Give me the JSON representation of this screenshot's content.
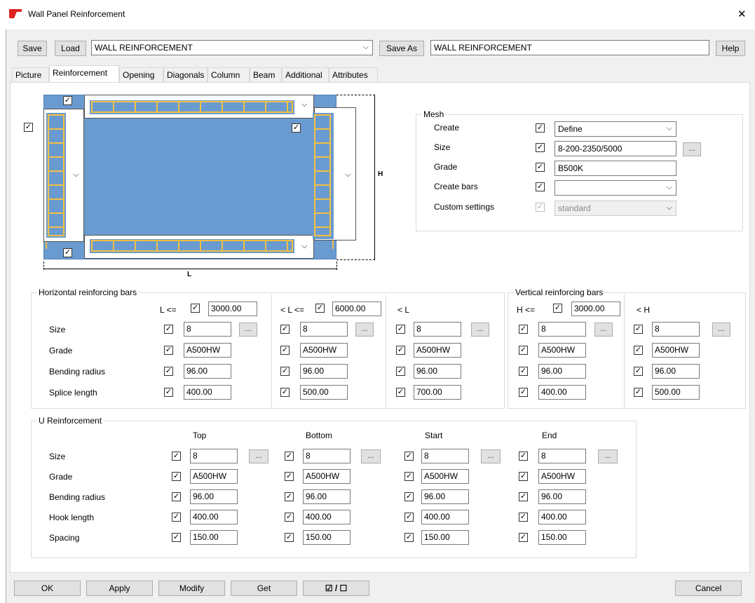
{
  "window": {
    "title": "Wall Panel Reinforcement",
    "close": "✕"
  },
  "toolbar": {
    "save": "Save",
    "load": "Load",
    "preset": "WALL REINFORCEMENT",
    "save_as": "Save As",
    "save_as_name": "WALL REINFORCEMENT",
    "help": "Help"
  },
  "tabs": [
    "Picture",
    "Reinforcement",
    "Opening",
    "Diagonals",
    "Column",
    "Beam",
    "Additional",
    "Attributes"
  ],
  "picture": {
    "h_label": "H",
    "l_label": "L"
  },
  "mesh": {
    "title": "Mesh",
    "rows": [
      {
        "label": "Create",
        "value": "Define"
      },
      {
        "label": "Size",
        "value": "8-200-2350/5000"
      },
      {
        "label": "Grade",
        "value": "B500K"
      },
      {
        "label": "Create bars",
        "value": ""
      },
      {
        "label": "Custom settings",
        "value": "standard"
      }
    ]
  },
  "horizontal": {
    "title": "Horizontal reinforcing bars",
    "cond": [
      {
        "label": "L <=",
        "value": "3000.00"
      },
      {
        "label": "< L <=",
        "value": "6000.00"
      },
      {
        "label": "< L",
        "value": ""
      }
    ],
    "rows": [
      "Size",
      "Grade",
      "Bending radius",
      "Splice length"
    ],
    "cols": [
      [
        "8",
        "A500HW",
        "96.00",
        "400.00"
      ],
      [
        "8",
        "A500HW",
        "96.00",
        "500.00"
      ],
      [
        "8",
        "A500HW",
        "96.00",
        "700.00"
      ]
    ]
  },
  "vertical": {
    "title": "Vertical reinforcing bars",
    "cond": [
      {
        "label": "H <=",
        "value": "3000.00"
      },
      {
        "label": "< H",
        "value": ""
      }
    ],
    "cols": [
      [
        "8",
        "A500HW",
        "96.00",
        "400.00"
      ],
      [
        "8",
        "A500HW",
        "96.00",
        "500.00"
      ]
    ]
  },
  "u": {
    "title": "U Reinforcement",
    "headers": [
      "Top",
      "Bottom",
      "Start",
      "End"
    ],
    "rows": [
      "Size",
      "Grade",
      "Bending radius",
      "Hook length",
      "Spacing"
    ],
    "cols": [
      [
        "8",
        "A500HW",
        "96.00",
        "400.00",
        "150.00"
      ],
      [
        "8",
        "A500HW",
        "96.00",
        "400.00",
        "150.00"
      ],
      [
        "8",
        "A500HW",
        "96.00",
        "400.00",
        "150.00"
      ],
      [
        "8",
        "A500HW",
        "96.00",
        "400.00",
        "150.00"
      ]
    ]
  },
  "footer": {
    "ok": "OK",
    "apply": "Apply",
    "modify": "Modify",
    "get": "Get",
    "toggle": "☑ / ☐",
    "cancel": "Cancel"
  },
  "check": "✓",
  "dots": "...",
  "arrow": "⌵"
}
